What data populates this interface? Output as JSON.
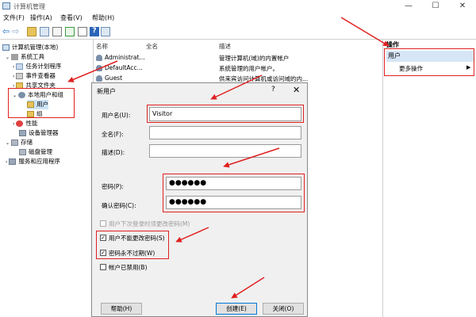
{
  "window": {
    "title": "计算机管理",
    "minimize": "—",
    "maximize": "☐",
    "close": "✕"
  },
  "menu": [
    "文件(F)",
    "操作(A)",
    "查看(V)",
    "帮助(H)"
  ],
  "tree": {
    "root": "计算机管理(本地)",
    "system_tools": "系统工具",
    "task_scheduler": "任务计划程序",
    "event_viewer": "事件查看器",
    "shared_folders": "共享文件夹",
    "local_users_groups": "本地用户和组",
    "users": "用户",
    "groups": "组",
    "performance": "性能",
    "device_manager": "设备管理器",
    "storage": "存储",
    "disk_management": "磁盘管理",
    "services_apps": "服务和应用程序"
  },
  "list": {
    "columns": [
      "名称",
      "全名",
      "描述"
    ],
    "rows": [
      {
        "name": "Administrat...",
        "fullname": "",
        "desc": "管理计算机(域)的内置帐户"
      },
      {
        "name": "DefaultAcc...",
        "fullname": "",
        "desc": "系统管理的用户帐户。"
      },
      {
        "name": "Guest",
        "fullname": "",
        "desc": "供来宾访问计算机或访问域的内..."
      }
    ]
  },
  "actions": {
    "header": "操作",
    "selected": "用户",
    "more": "更多操作",
    "more_arrow": "▶"
  },
  "dialog": {
    "title": "新用户",
    "help_glyph": "?",
    "close_glyph": "✕",
    "username_label": "用户名(U):",
    "username_value": "Visitor",
    "fullname_label": "全名(F):",
    "fullname_value": "",
    "description_label": "描述(D):",
    "description_value": "",
    "password_label": "密码(P):",
    "password_value": "●●●●●●",
    "confirm_label": "确认密码(C):",
    "confirm_value": "●●●●●●",
    "cb_must_change": "用户下次登录时须更改密码(M)",
    "cb_cannot_change": "用户不能更改密码(S)",
    "cb_never_expires": "密码永不过期(W)",
    "cb_disabled": "帐户已禁用(B)",
    "check_glyph": "✓",
    "help_button": "帮助(H)",
    "create_button": "创建(E)",
    "close_button": "关闭(O)"
  },
  "colors": {
    "annotation": "#e02020",
    "selection": "#d6e6f7",
    "primary_border": "#0078d7"
  }
}
